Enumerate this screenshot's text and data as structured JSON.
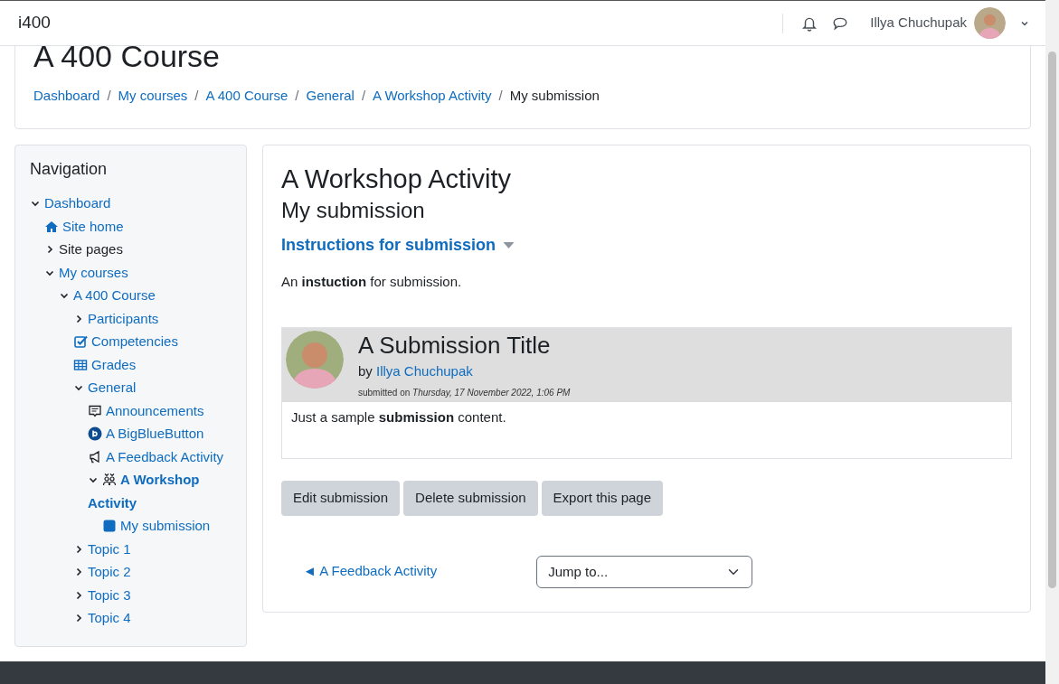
{
  "navbar": {
    "brand": "i400",
    "user_name": "Illya Chuchupak"
  },
  "header": {
    "title": "A 400 Course",
    "separator": "/",
    "breadcrumbs": [
      {
        "label": "Dashboard",
        "current": false
      },
      {
        "label": "My courses",
        "current": false
      },
      {
        "label": "A 400 Course",
        "current": false
      },
      {
        "label": "General",
        "current": false
      },
      {
        "label": "A Workshop Activity",
        "current": false
      },
      {
        "label": "My submission",
        "current": true
      }
    ]
  },
  "navigation": {
    "title": "Navigation",
    "items": [
      {
        "label": "Dashboard",
        "expanded": true,
        "link": true,
        "current": false,
        "children": [
          {
            "label": "Site home",
            "kind": "home",
            "link": true,
            "current": false
          },
          {
            "label": "Site pages",
            "expanded": false,
            "link": false,
            "current": false
          },
          {
            "label": "My courses",
            "expanded": true,
            "link": true,
            "current": false,
            "children": [
              {
                "label": "A 400 Course",
                "expanded": true,
                "link": true,
                "current": false,
                "children": [
                  {
                    "label": "Participants",
                    "expanded": false,
                    "link": true,
                    "current": false
                  },
                  {
                    "label": "Competencies",
                    "kind": "competency",
                    "link": true,
                    "current": false
                  },
                  {
                    "label": "Grades",
                    "kind": "grades",
                    "link": true,
                    "current": false
                  },
                  {
                    "label": "General",
                    "expanded": true,
                    "link": true,
                    "current": false,
                    "children": [
                      {
                        "label": "Announcements",
                        "kind": "forum",
                        "link": true,
                        "current": false
                      },
                      {
                        "label": "A BigBlueButton",
                        "kind": "bbb",
                        "link": true,
                        "current": false
                      },
                      {
                        "label": "A Feedback Activity",
                        "kind": "feedback",
                        "link": true,
                        "current": false
                      },
                      {
                        "label": "A Workshop Activity",
                        "kind": "workshop",
                        "expanded": true,
                        "link": true,
                        "current": true,
                        "children": [
                          {
                            "label": "My submission",
                            "kind": "submission",
                            "link": true,
                            "current": false
                          }
                        ]
                      }
                    ]
                  },
                  {
                    "label": "Topic 1",
                    "expanded": false,
                    "link": true,
                    "current": false
                  },
                  {
                    "label": "Topic 2",
                    "expanded": false,
                    "link": true,
                    "current": false
                  },
                  {
                    "label": "Topic 3",
                    "expanded": false,
                    "link": true,
                    "current": false
                  },
                  {
                    "label": "Topic 4",
                    "expanded": false,
                    "link": true,
                    "current": false
                  }
                ]
              }
            ]
          }
        ]
      }
    ]
  },
  "main": {
    "title": "A Workshop Activity",
    "subtitle": "My submission",
    "instructions": {
      "heading": "Instructions for submission",
      "expanded": true,
      "text": "An **instuction** for submission."
    },
    "submission": {
      "title": "A Submission Title",
      "by": "by",
      "author": "Illya Chuchupak",
      "submitted": "submitted on *Thursday, 17 November 2022, 1:06 PM*",
      "content": "Just a sample **submission** content."
    },
    "buttons": [
      "Edit submission",
      "Delete submission",
      "Export this page"
    ],
    "prev_link": "◄ A Feedback Activity",
    "jump": {
      "value": "Jump to..."
    }
  }
}
